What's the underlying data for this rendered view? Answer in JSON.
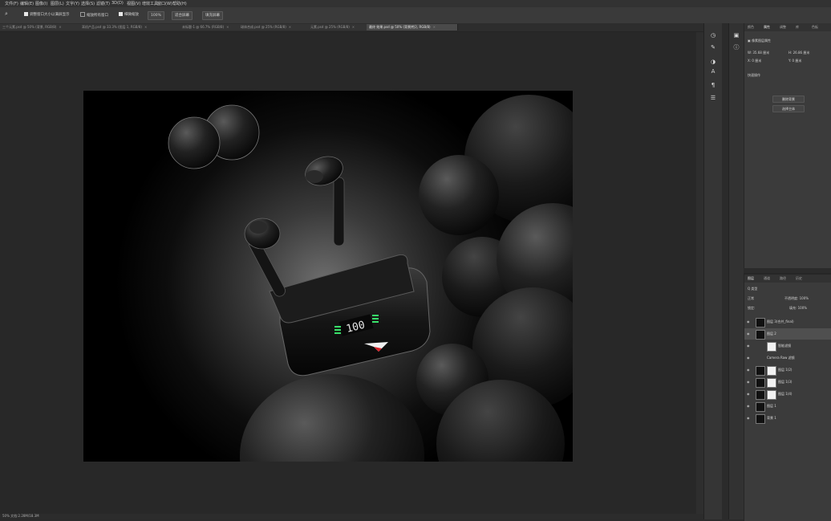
{
  "menu": [
    "文件(F)",
    "编辑(E)",
    "图像(I)",
    "图层(L)",
    "文字(Y)",
    "选择(S)",
    "滤镜(T)",
    "3D(D)",
    "视图(V)",
    "增效工具",
    "窗口(W)",
    "帮助(H)"
  ],
  "options_bar": {
    "tool_icon": "magnifier-icon",
    "checkbox_resize": "调整窗口大小以满屏显示",
    "checkbox_zoom_all": "缩放所有窗口",
    "checkbox_scrubby": "细微缩放",
    "zoom_value": "100%",
    "fit_screen_button": "适合屏幕",
    "fill_screen_button": "填充屏幕"
  },
  "tabs": [
    {
      "label": "三个元素.psd @ 50% (背景, RGB/8)",
      "active": false
    },
    {
      "label": "耳机产品.psd @ 33.3% (图层 1, RGB/8)",
      "active": false
    },
    {
      "label": "未标题-1 @ 66.7% (RGB/8)",
      "active": false
    },
    {
      "label": "球体合成.psd @ 25% (RGB/8)",
      "active": false
    },
    {
      "label": "元素.psd @ 25% (RGB/8)",
      "active": false
    },
    {
      "label": "最终 效果.psd @ 50% (背景拷贝, RGB/8)",
      "active": true
    }
  ],
  "canvas": {
    "case_display": "100",
    "accent_green": "#38e06a",
    "logo_red": "#d8232a"
  },
  "status": "50% 文档:2.28M/18.3M",
  "right_tools": [
    "history-icon",
    "brush-settings-icon",
    "adjust-icon",
    "character-icon",
    "paragraph-icon",
    "properties-icon",
    "libraries-icon",
    "info-icon"
  ],
  "properties": {
    "tabs": [
      "颜色",
      "属性",
      "调整",
      "库",
      "色板"
    ],
    "active_tab": "属性",
    "layer_label": "像素图层属性",
    "w_label": "W",
    "w_value": "35.68 厘米",
    "h_label": "H",
    "h_value": "26.86 厘米",
    "x_label": "X",
    "x_value": "0 厘米",
    "y_label": "Y",
    "y_value": "0 厘米",
    "section": "快速操作",
    "button1": "删除背景",
    "button2": "选择主体"
  },
  "layers_panel": {
    "tabs": [
      "图层",
      "通道",
      "路径",
      "历史"
    ],
    "kind_label": "Q 类型",
    "mode": "正常",
    "opacity_label": "不透明度:",
    "opacity": "100%",
    "lock_label": "锁定:",
    "fill_label": "填充:",
    "fill": "100%",
    "layers": [
      {
        "name": "图层 3(合并_final)",
        "thumb": "dark",
        "selected": false,
        "indent": false
      },
      {
        "name": "图层 2",
        "thumb": "dark",
        "selected": true,
        "indent": false
      },
      {
        "name": "智能滤镜",
        "thumb": "white",
        "selected": false,
        "indent": true
      },
      {
        "name": "Camera Raw 滤镜",
        "thumb": "none",
        "selected": false,
        "indent": true
      },
      {
        "name": "图层 1(2)",
        "thumb": "mask",
        "selected": false,
        "indent": false
      },
      {
        "name": "图层 1(3)",
        "thumb": "mask",
        "selected": false,
        "indent": false
      },
      {
        "name": "图层 1(4)",
        "thumb": "mask",
        "selected": false,
        "indent": false
      },
      {
        "name": "图层 1",
        "thumb": "dark",
        "selected": false,
        "indent": false
      },
      {
        "name": "背景 1",
        "thumb": "dark",
        "selected": false,
        "indent": false
      }
    ]
  }
}
